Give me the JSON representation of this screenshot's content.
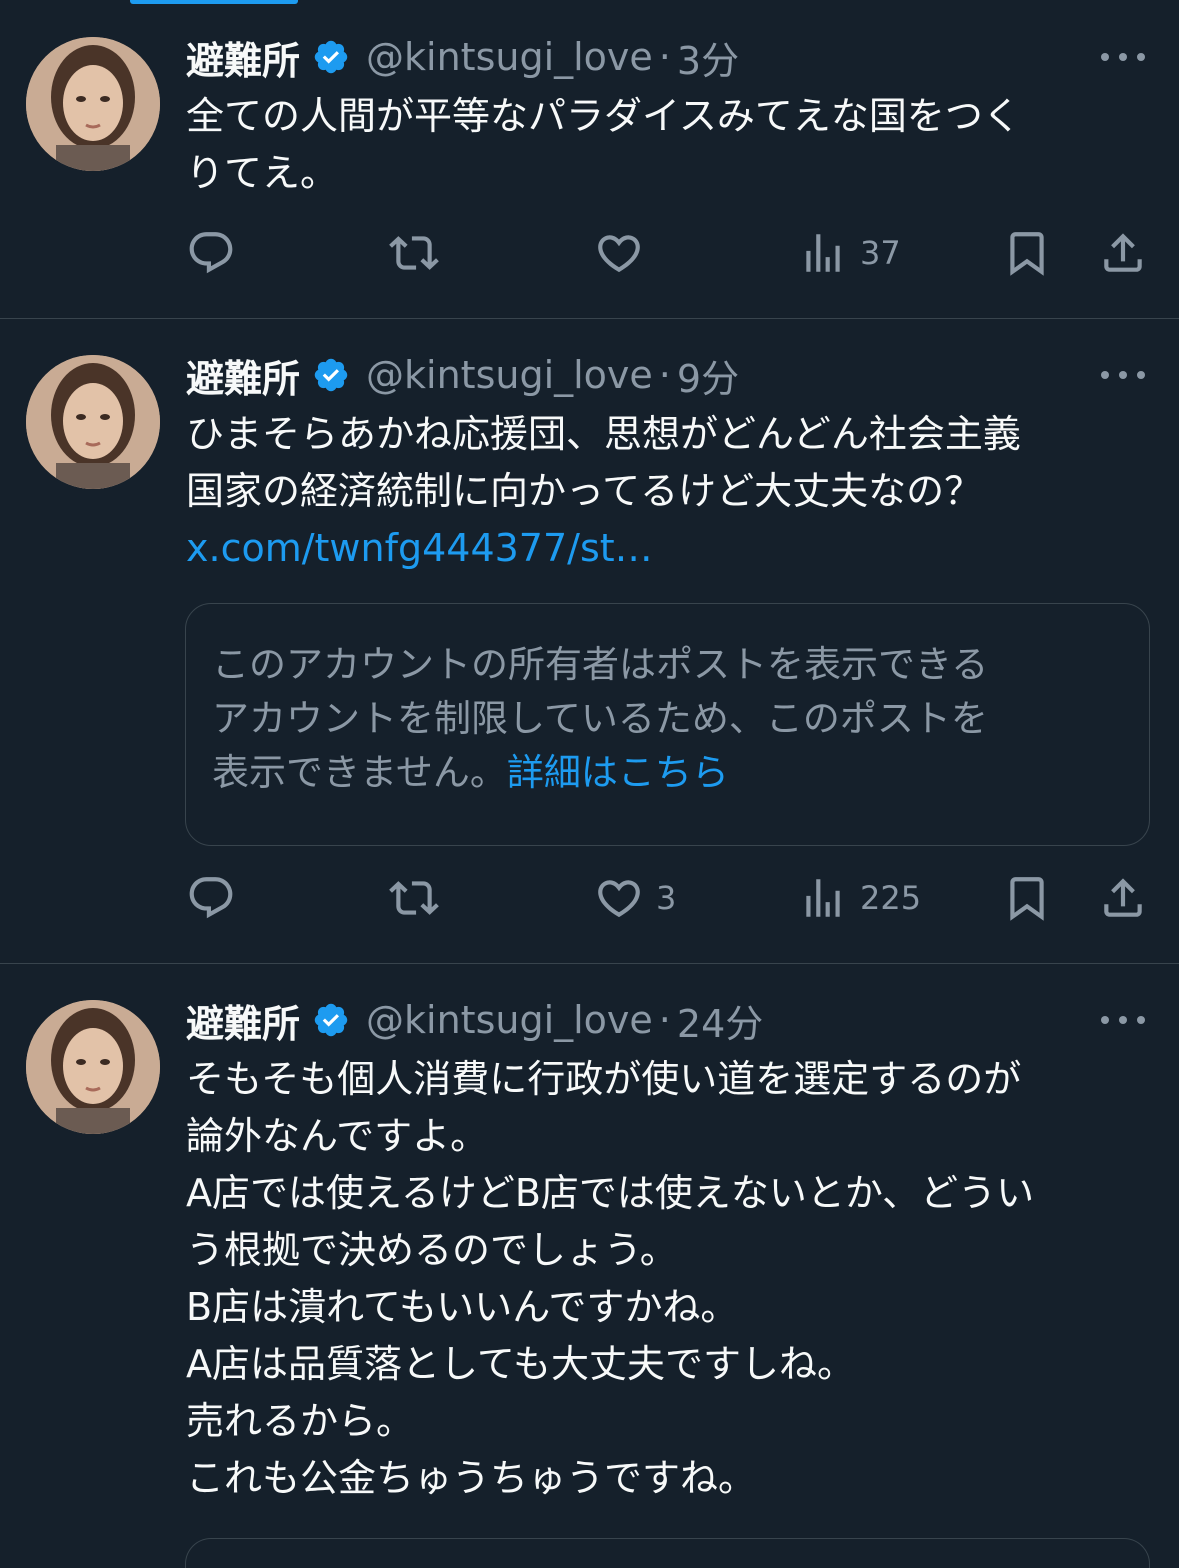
{
  "colors": {
    "background": "#15202b",
    "text_primary": "#f7f9f9",
    "text_secondary": "#8b98a5",
    "accent": "#1d9bf0",
    "divider": "#38444d"
  },
  "tweets": [
    {
      "name": "避難所",
      "handle": "@kintsugi_love",
      "separator": "·",
      "time": "3分",
      "lines": [
        "全ての人間が平等なパラダイスみてえな国をつく",
        "りてえ。"
      ],
      "actions": {
        "reply": "",
        "retweet": "",
        "like": "",
        "views": "37"
      }
    },
    {
      "name": "避難所",
      "handle": "@kintsugi_love",
      "separator": "·",
      "time": "9分",
      "lines": [
        "ひまそらあかね応援団、思想がどんどん社会主義",
        "国家の経済統制に向かってるけど大丈夫なの？"
      ],
      "link": "x.com/twnfg444377/st…",
      "card": {
        "lines": [
          "このアカウントの所有者はポストを表示できる",
          "アカウントを制限しているため、このポストを",
          "表示できません。"
        ],
        "learn_more": "詳細はこちら"
      },
      "actions": {
        "reply": "",
        "retweet": "",
        "like": "3",
        "views": "225"
      }
    },
    {
      "name": "避難所",
      "handle": "@kintsugi_love",
      "separator": "·",
      "time": "24分",
      "lines": [
        "そもそも個人消費に行政が使い道を選定するのが",
        "論外なんですよ。",
        "A店では使えるけどB店では使えないとか、どうい",
        "う根拠で決めるのでしょう。",
        "B店は潰れてもいいんですかね。",
        "A店は品質落としても大丈夫ですしね。",
        "売れるから。",
        "これも公金ちゅうちゅうですね。"
      ]
    }
  ]
}
